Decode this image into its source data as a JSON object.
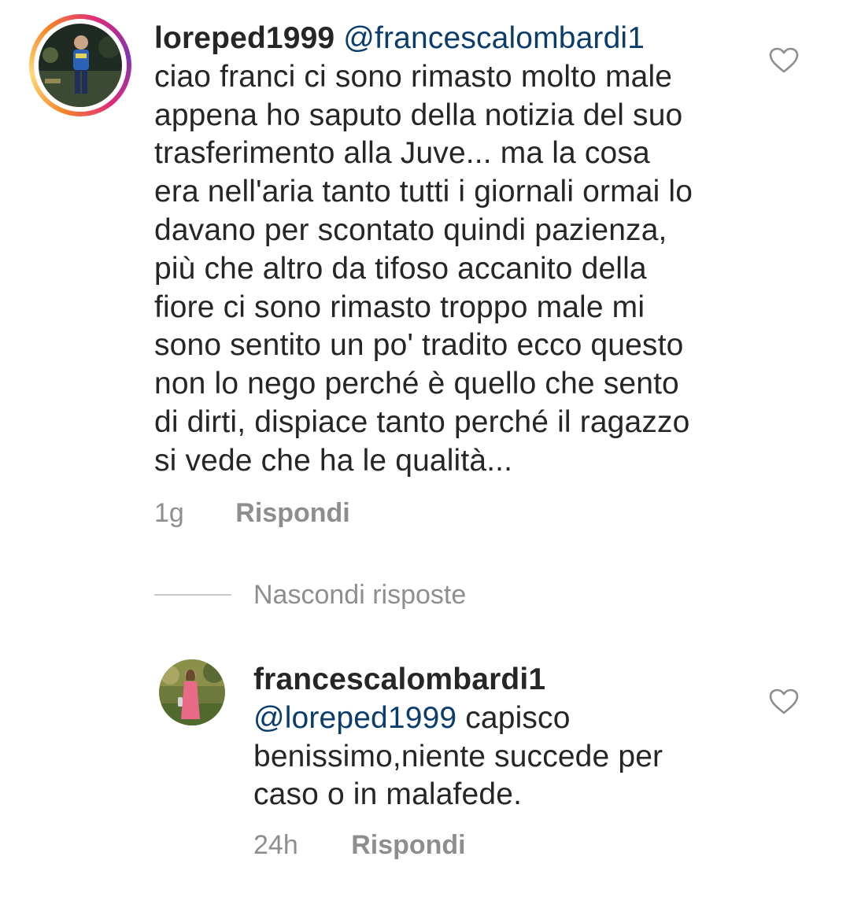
{
  "comment": {
    "username": "loreped1999",
    "mention": "@francescalombardi1",
    "lines": [
      "ciao franci ci sono rimasto molto male",
      "appena ho saputo della notizia del suo",
      "trasferimento alla Juve... ma la cosa",
      "era nell'aria tanto tutti i giornali ormai lo",
      "davano per scontato quindi pazienza,",
      "più che altro da tifoso accanito della",
      "fiore ci sono rimasto troppo male mi",
      "sono sentito un po' tradito ecco questo",
      "non lo nego perché è quello che sento",
      "di dirti, dispiace tanto perché il ragazzo",
      "si vede che ha le qualità..."
    ],
    "time": "1g",
    "reply_label": "Rispondi",
    "like_icon": "heart-outline-icon"
  },
  "replies_toggle": {
    "label": "Nascondi risposte"
  },
  "reply": {
    "username": "francescalombardi1",
    "mention": "@loreped1999",
    "first_line_text": " capisco",
    "lines": [
      "benissimo,niente succede per",
      "caso o in malafede."
    ],
    "time": "24h",
    "reply_label": "Rispondi",
    "like_icon": "heart-outline-icon"
  },
  "colors": {
    "text": "#262626",
    "mention": "#0a3d6b",
    "secondary": "#8e8e8e",
    "story_ring": [
      "#f58529",
      "#dd2a7b",
      "#8134af"
    ]
  }
}
